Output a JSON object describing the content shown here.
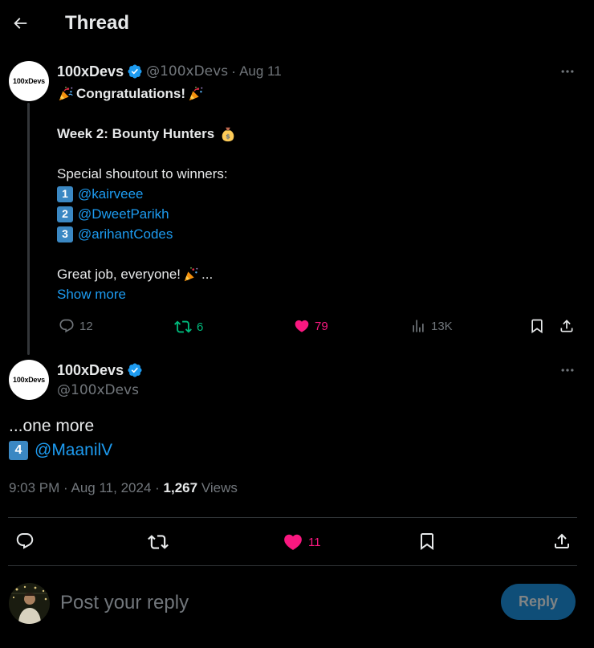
{
  "header": {
    "title": "Thread"
  },
  "first_tweet": {
    "avatar_text": "100xDevs",
    "display_name": "100xDevs",
    "handle": "@100xDevs",
    "separator": "·",
    "date": "Aug 11",
    "body": {
      "congrats": "Congratulations!",
      "week": "Week 2: Bounty Hunters",
      "shoutout": "Special shoutout to winners:",
      "winners": [
        {
          "rank": "1",
          "mention": "@kairveee"
        },
        {
          "rank": "2",
          "mention": "@DweetParikh"
        },
        {
          "rank": "3",
          "mention": "@arihantCodes"
        }
      ],
      "closing_a": "Great job, everyone!",
      "closing_b": "...",
      "show_more": "Show more"
    },
    "stats": {
      "replies": "12",
      "retweets": "6",
      "likes": "79",
      "views": "13K"
    }
  },
  "second_tweet": {
    "avatar_text": "100xDevs",
    "display_name": "100xDevs",
    "handle": "@100xDevs",
    "body_line1": "...one more",
    "rank": "4",
    "mention": "@MaanilV",
    "time": "9:03 PM",
    "separator": "·",
    "date": "Aug 11, 2024",
    "separator2": "·",
    "views_count": "1,267",
    "views_label": "Views",
    "likes": "11"
  },
  "reply": {
    "placeholder": "Post your reply",
    "button_label": "Reply"
  },
  "colors": {
    "accent": "#1d9bf0",
    "like": "#f91880",
    "retweet": "#00ba7c",
    "muted": "#71767b",
    "keycap": "#3b88c3"
  },
  "icons": [
    "back-arrow-icon",
    "verified-badge-icon",
    "more-icon",
    "party-popper-icon",
    "money-bag-icon",
    "reply-icon",
    "retweet-icon",
    "heart-icon",
    "views-icon",
    "bookmark-icon",
    "share-icon"
  ]
}
